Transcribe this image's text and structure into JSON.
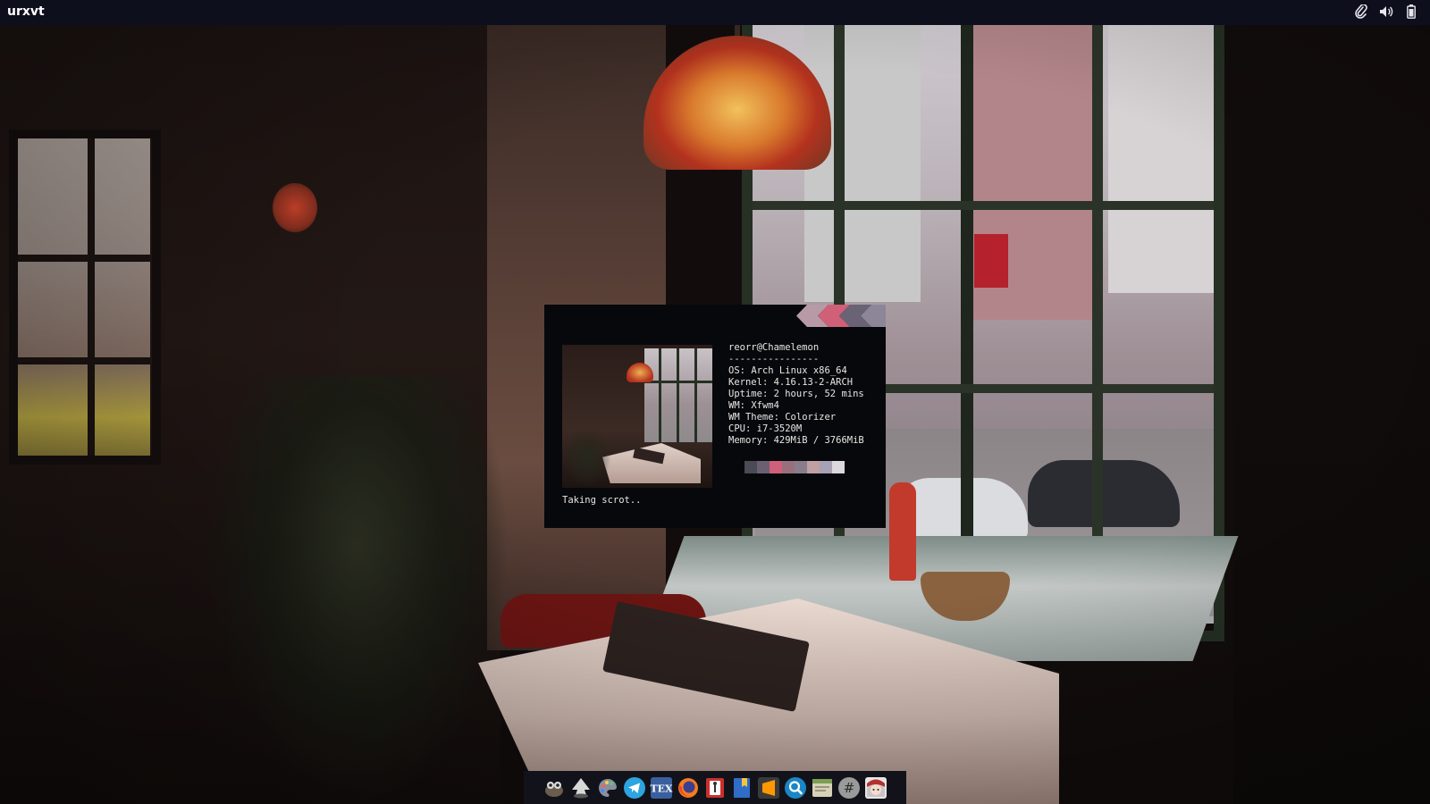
{
  "panel": {
    "title": "urxvt",
    "tray": [
      {
        "name": "paperclip-icon"
      },
      {
        "name": "volume-icon"
      },
      {
        "name": "battery-icon"
      }
    ]
  },
  "terminal": {
    "user_host": "reorr@Chamelemon",
    "separator": "----------------",
    "info": [
      {
        "key": "OS",
        "value": "Arch Linux x86_64"
      },
      {
        "key": "Kernel",
        "value": "4.16.13-2-ARCH"
      },
      {
        "key": "Uptime",
        "value": "2 hours, 52 mins"
      },
      {
        "key": "WM",
        "value": "Xfwm4"
      },
      {
        "key": "WM Theme",
        "value": "Colorizer"
      },
      {
        "key": "CPU",
        "value": "i7-3520M"
      },
      {
        "key": "Memory",
        "value": "429MiB / 3766MiB"
      }
    ],
    "status": "Taking scrot..",
    "palette": [
      "#4a4b55",
      "#6b5f72",
      "#d0607a",
      "#9a6f7d",
      "#8a7d8b",
      "#bfa0a3",
      "#a6a1b5",
      "#dcd8dc"
    ],
    "title_deco_colors": [
      "#b79aa6",
      "#d06078",
      "#6a6375",
      "#8d8699"
    ]
  },
  "dock": {
    "items": [
      {
        "name": "gimp-icon"
      },
      {
        "name": "inkscape-icon"
      },
      {
        "name": "color-palette-icon"
      },
      {
        "name": "telegram-icon"
      },
      {
        "name": "tex-icon",
        "label": "TEX"
      },
      {
        "name": "firefox-icon"
      },
      {
        "name": "keepass-icon"
      },
      {
        "name": "bookmark-icon"
      },
      {
        "name": "sublime-text-icon"
      },
      {
        "name": "search-icon"
      },
      {
        "name": "file-manager-icon"
      },
      {
        "name": "terminal-hash-icon",
        "label": "#"
      },
      {
        "name": "avatar-icon"
      }
    ]
  }
}
